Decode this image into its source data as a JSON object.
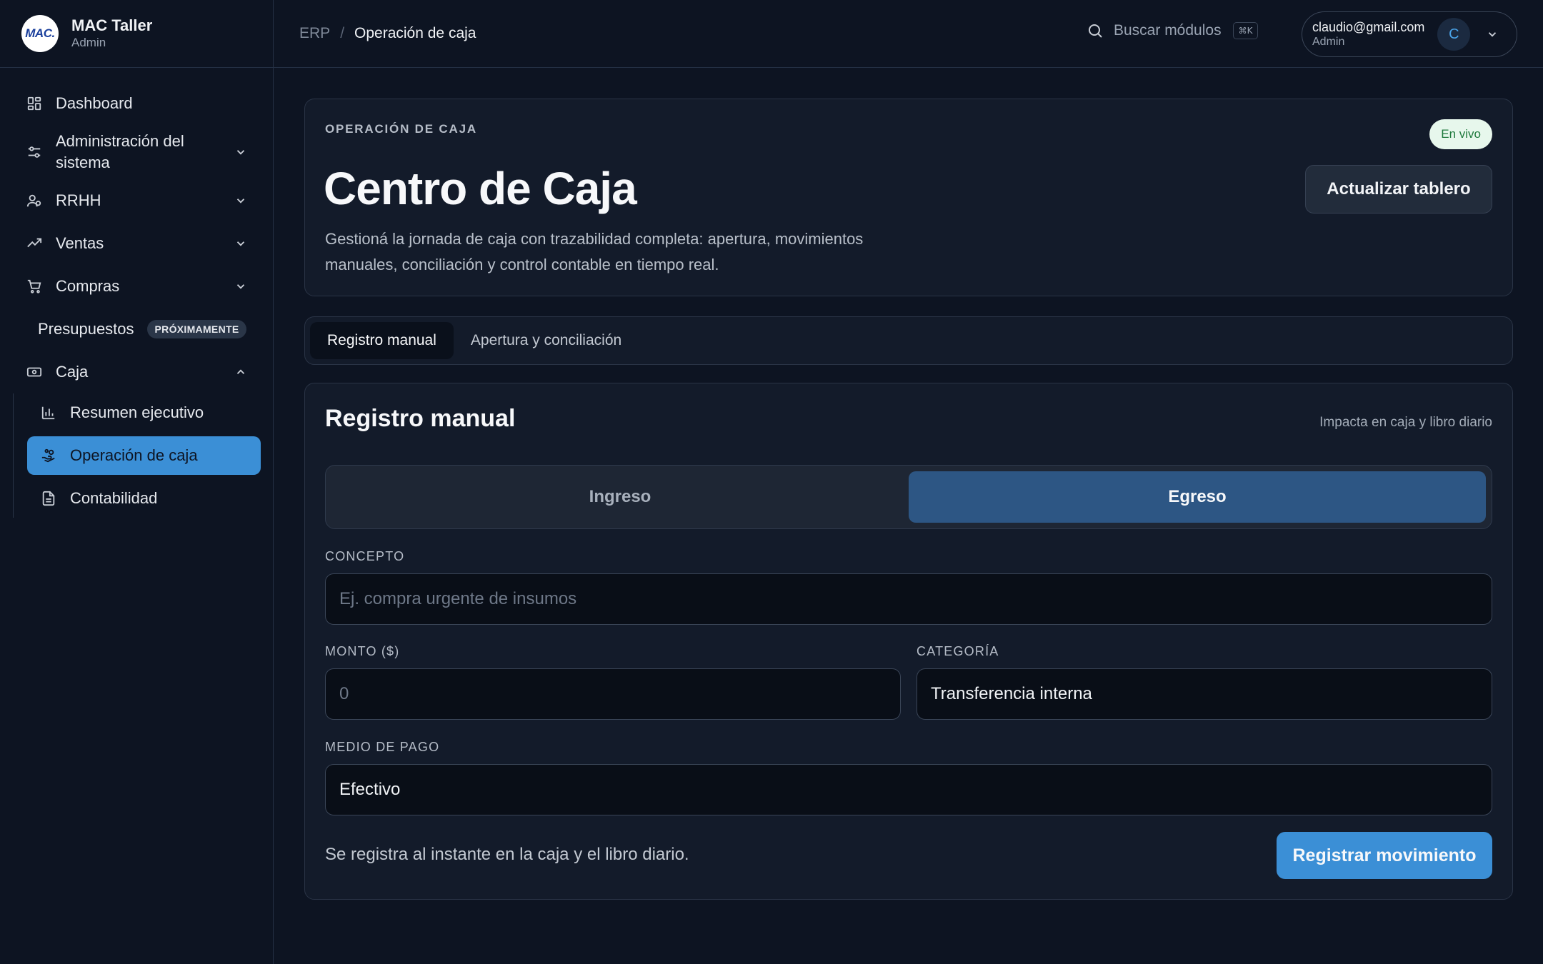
{
  "brand": {
    "logo_text": "MAC.",
    "name": "MAC Taller",
    "role": "Admin"
  },
  "sidebar": {
    "items": [
      {
        "label": "Dashboard",
        "icon": "dashboard-icon"
      },
      {
        "label": "Administración del sistema",
        "icon": "sliders-icon"
      },
      {
        "label": "RRHH",
        "icon": "users-icon"
      },
      {
        "label": "Ventas",
        "icon": "trend-icon"
      },
      {
        "label": "Compras",
        "icon": "cart-icon"
      },
      {
        "label": "Presupuestos",
        "badge": "PRÓXIMAMENTE"
      },
      {
        "label": "Caja",
        "icon": "cash-icon"
      }
    ],
    "caja_sub": [
      {
        "label": "Resumen ejecutivo",
        "icon": "bar-chart-icon"
      },
      {
        "label": "Operación de caja",
        "icon": "hand-coins-icon",
        "active": true
      },
      {
        "label": "Contabilidad",
        "icon": "document-icon"
      }
    ]
  },
  "topbar": {
    "breadcrumb_root": "ERP",
    "breadcrumb_sep": "/",
    "breadcrumb_current": "Operación de caja",
    "search_label": "Buscar módulos",
    "search_shortcut": "⌘K",
    "user_email": "claudio@gmail.com",
    "user_role": "Admin",
    "avatar_letter": "C"
  },
  "hero": {
    "eyebrow": "OPERACIÓN DE CAJA",
    "title": "Centro de Caja",
    "description": "Gestioná la jornada de caja con trazabilidad completa: apertura, movimientos manuales, conciliación y control contable en tiempo real.",
    "status_badge": "En vivo",
    "refresh_label": "Actualizar tablero"
  },
  "tabs": [
    {
      "label": "Registro manual",
      "active": true
    },
    {
      "label": "Apertura y conciliación",
      "active": false
    }
  ],
  "form": {
    "title": "Registro manual",
    "note": "Impacta en caja y libro diario",
    "type_options": [
      "Ingreso",
      "Egreso"
    ],
    "type_selected": "Egreso",
    "concepto_label": "CONCEPTO",
    "concepto_placeholder": "Ej. compra urgente de insumos",
    "monto_label": "MONTO ($)",
    "monto_placeholder": "0",
    "categoria_label": "CATEGORÍA",
    "categoria_value": "Transferencia interna",
    "medio_label": "MEDIO DE PAGO",
    "medio_value": "Efectivo",
    "footer_note": "Se registra al instante en la caja y el libro diario.",
    "submit_label": "Registrar movimiento"
  },
  "colors": {
    "accent": "#3b8fd6",
    "background": "#0d1422",
    "card": "#131b2a",
    "segment_active": "#2d5684",
    "live_badge_bg": "#e7f7ec",
    "live_badge_text": "#1f7a3d"
  }
}
